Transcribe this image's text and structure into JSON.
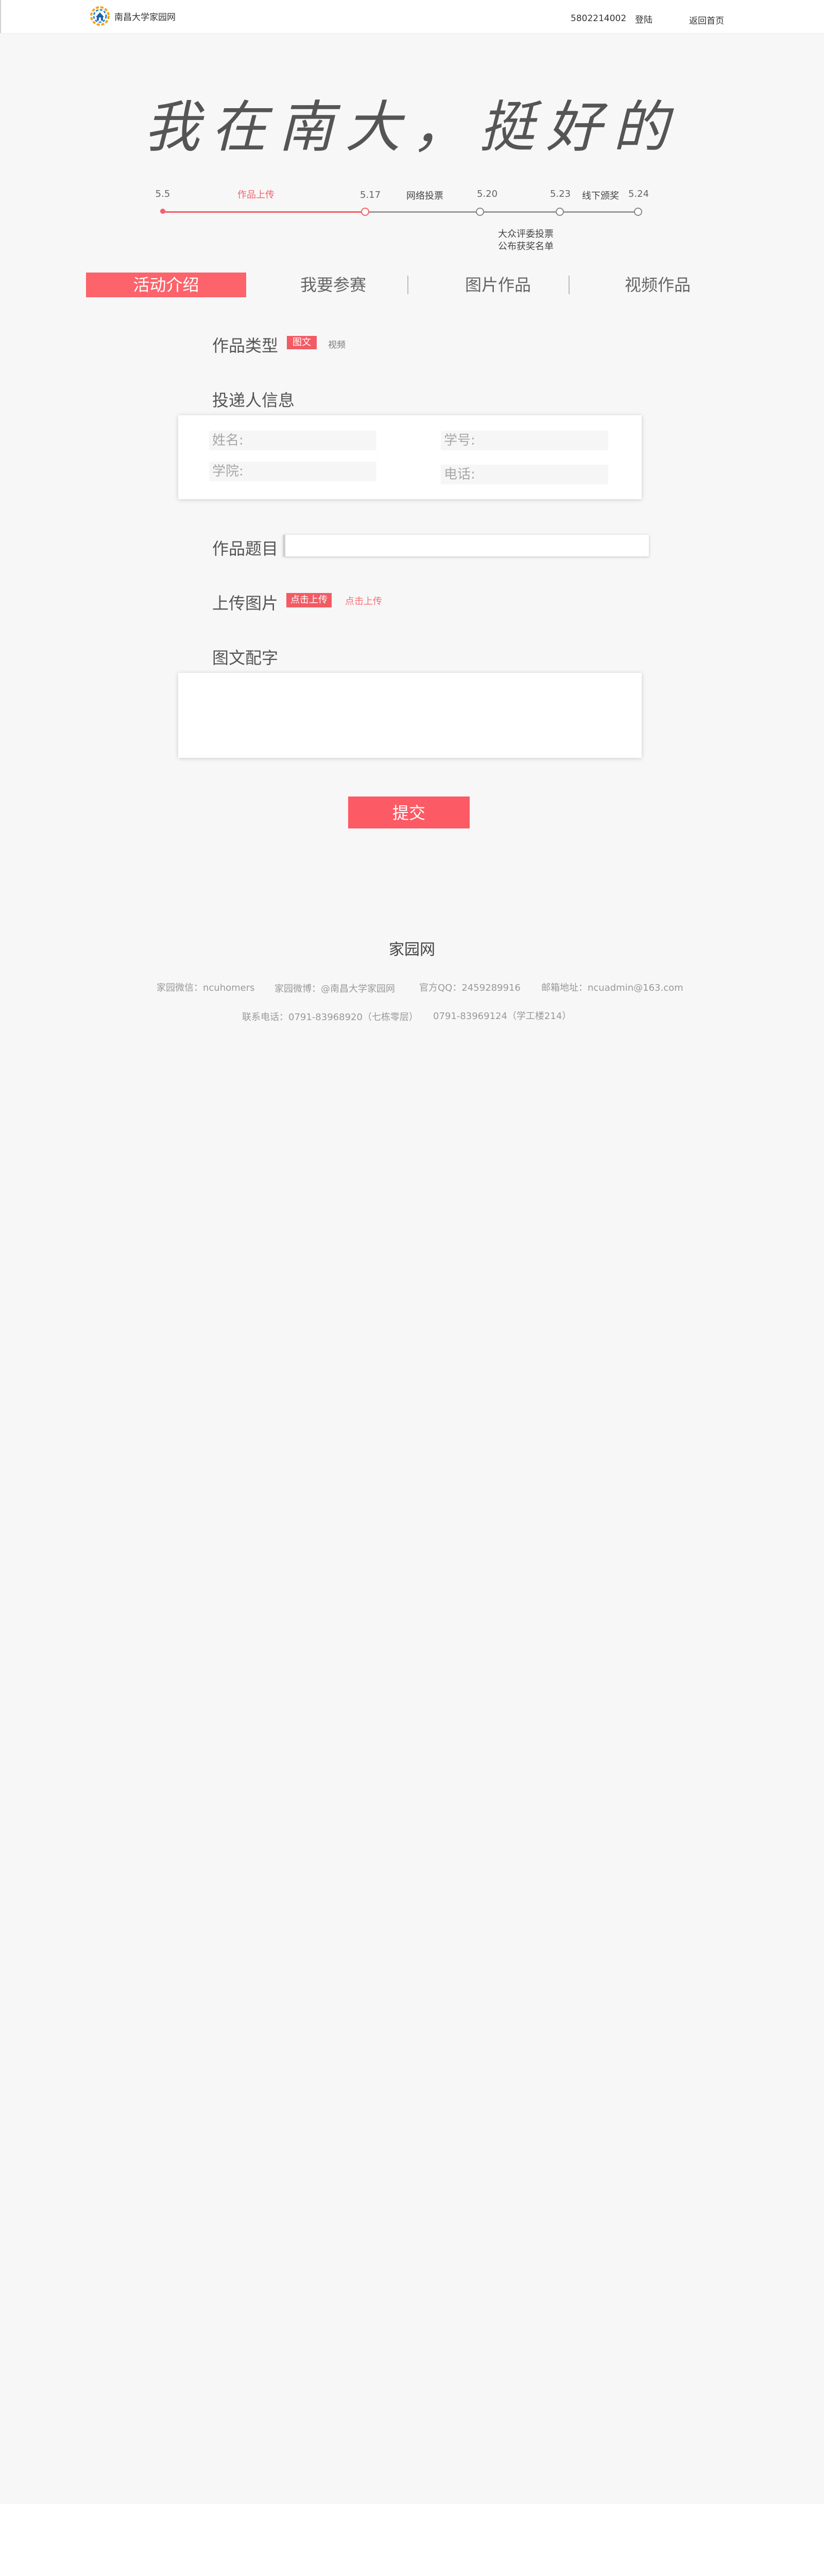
{
  "header": {
    "logo_text": "南昌大学家园网",
    "user_id": "5802214002",
    "login_label": "登陆",
    "home_label": "返回首页"
  },
  "hero": {
    "title": "我在南大，挺好的"
  },
  "timeline": {
    "dates": [
      "5.5",
      "5.17",
      "5.20",
      "5.23",
      "5.24"
    ],
    "labels": {
      "upload": "作品上传",
      "online_vote": "网络投票",
      "offline_award": "线下颁奖",
      "public_vote": "大众评委投票",
      "announce": "公布获奖名单"
    },
    "colors": {
      "active": "#f5606a",
      "inactive": "#888888"
    }
  },
  "tabs": [
    "活动介绍",
    "我要参赛",
    "图片作品",
    "视频作品"
  ],
  "active_tab": "活动介绍",
  "form": {
    "type_section": {
      "title": "作品类型",
      "option_selected": "图文",
      "option_other": "视频"
    },
    "submitter_section": {
      "title": "投递人信息",
      "name_placeholder": "姓名:",
      "student_id_placeholder": "学号:",
      "college_placeholder": "学院:",
      "phone_placeholder": "电话:"
    },
    "title_section": {
      "title": "作品题目",
      "value": ""
    },
    "upload_section": {
      "title": "上传图片",
      "button_primary": "点击上传",
      "button_secondary": "点击上传"
    },
    "caption_section": {
      "title": "图文配字",
      "value": ""
    },
    "submit_label": "提交"
  },
  "footer": {
    "title": "家园网",
    "wechat": "家园微信：ncuhomers",
    "weibo": "家园微博：@南昌大学家园网",
    "qq": "官方QQ：2459289916",
    "email": "邮箱地址：ncuadmin@163.com",
    "phone1": "联系电话：0791-83968920（七栋零层）",
    "phone2": "0791-83969124（学工楼214）"
  },
  "colors": {
    "accent": "#fc636b",
    "background": "#f7f7f7"
  }
}
